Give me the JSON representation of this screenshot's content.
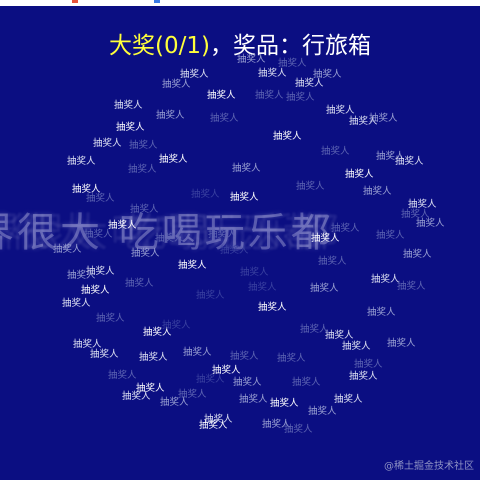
{
  "page": {
    "title_prize": "大奖(0/1)",
    "title_rest": "，奖品：行旅箱",
    "banner_text": "界很大  吃喝玩乐都",
    "watermark": "@稀土掘金技术社区",
    "candidate_label": "抽奖人",
    "colors": {
      "background": "#0b0e82",
      "title_highlight": "#ffff3b",
      "title_text": "#ffffff"
    }
  }
}
